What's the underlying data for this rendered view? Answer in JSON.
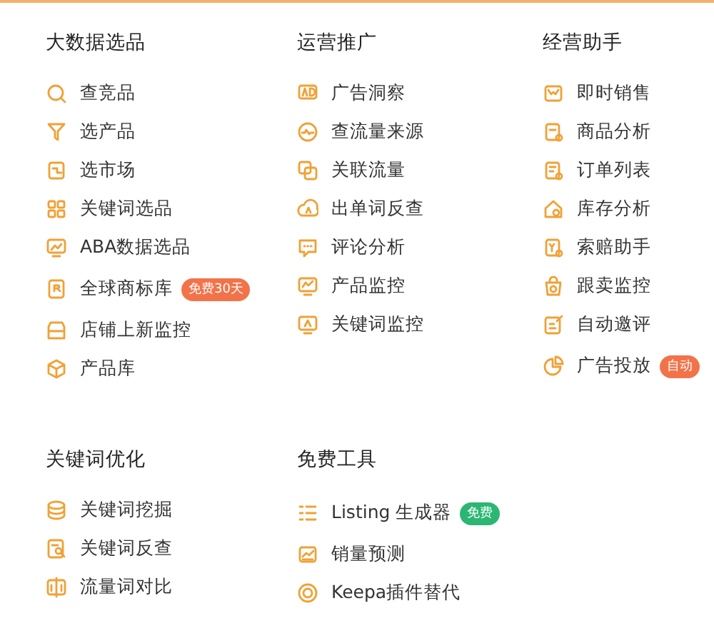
{
  "sections": [
    {
      "title": "大数据选品",
      "items": [
        {
          "label": "查竞品"
        },
        {
          "label": "选产品"
        },
        {
          "label": "选市场"
        },
        {
          "label": "关键词选品"
        },
        {
          "label": "ABA数据选品"
        },
        {
          "label": "全球商标库",
          "badge": {
            "text": "免费30天",
            "color": "#f2734a"
          }
        },
        {
          "label": "店铺上新监控"
        },
        {
          "label": "产品库"
        }
      ]
    },
    {
      "title": "运营推广",
      "items": [
        {
          "label": "广告洞察"
        },
        {
          "label": "查流量来源"
        },
        {
          "label": "关联流量"
        },
        {
          "label": "出单词反查"
        },
        {
          "label": "评论分析"
        },
        {
          "label": "产品监控"
        },
        {
          "label": "关键词监控"
        }
      ]
    },
    {
      "title": "经营助手",
      "items": [
        {
          "label": "即时销售"
        },
        {
          "label": "商品分析"
        },
        {
          "label": "订单列表"
        },
        {
          "label": "库存分析"
        },
        {
          "label": "索赔助手"
        },
        {
          "label": "跟卖监控"
        },
        {
          "label": "自动邀评"
        },
        {
          "label": "广告投放",
          "badge": {
            "text": "自动",
            "color": "#f2734a"
          }
        }
      ]
    },
    {
      "title": "关键词优化",
      "items": [
        {
          "label": "关键词挖掘"
        },
        {
          "label": "关键词反查"
        },
        {
          "label": "流量词对比"
        }
      ]
    },
    {
      "title": "免费工具",
      "items": [
        {
          "label": "Listing 生成器",
          "badge": {
            "text": "免费",
            "color": "#2bb673"
          }
        },
        {
          "label": "销量预测"
        },
        {
          "label": "Keepa插件替代"
        }
      ]
    }
  ]
}
